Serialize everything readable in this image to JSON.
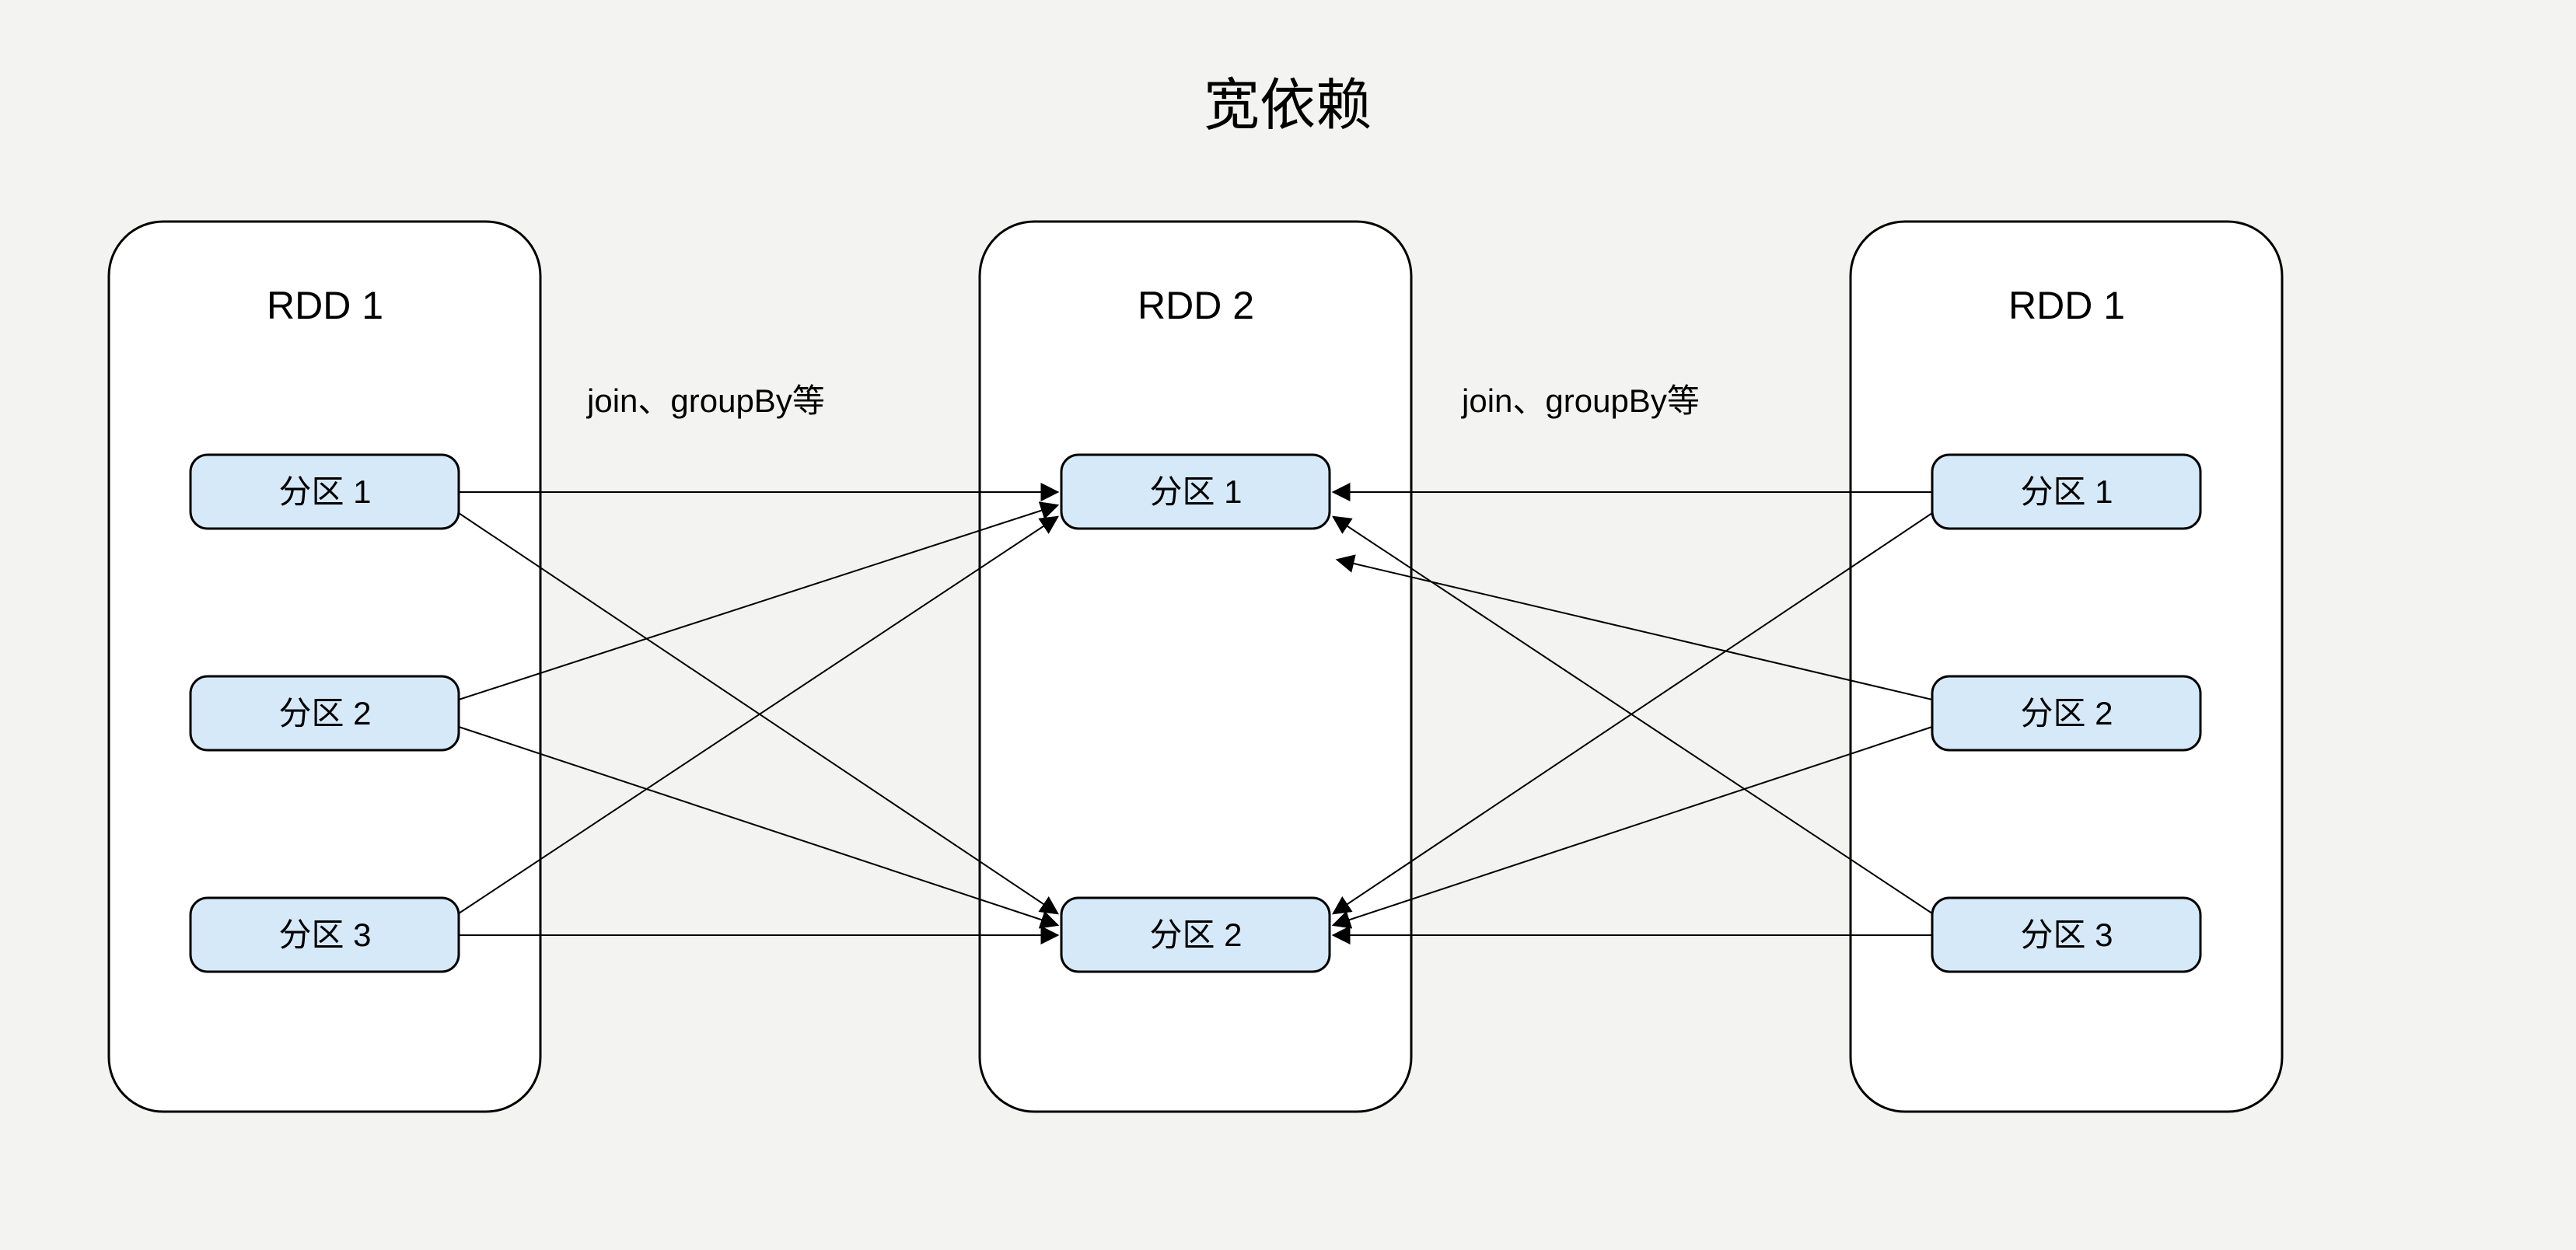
{
  "diagram": {
    "title": "宽依赖",
    "left_rdd": {
      "title": "RDD 1",
      "partitions": [
        "分区 1",
        "分区 2",
        "分区 3"
      ]
    },
    "center_rdd": {
      "title": "RDD 2",
      "partitions": [
        "分区 1",
        "分区 2"
      ]
    },
    "right_rdd": {
      "title": "RDD 1",
      "partitions": [
        "分区 1",
        "分区 2",
        "分区 3"
      ]
    },
    "op_label_left": "join、groupBy等",
    "op_label_right": "join、groupBy等"
  }
}
